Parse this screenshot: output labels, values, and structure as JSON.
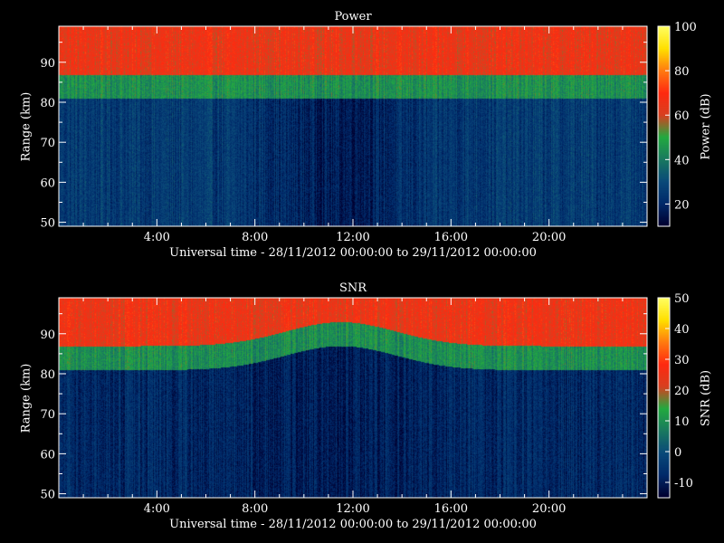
{
  "chart_data": [
    {
      "type": "heatmap",
      "title": "Power",
      "xlabel": "Universal time - 28/11/2012 00:00:00 to 29/11/2012 00:00:00",
      "ylabel": "Range (km)",
      "colorbar_label": "Power (dB)",
      "x_range_hours": [
        0,
        24
      ],
      "y_range_km": [
        49,
        99
      ],
      "x_ticks": [
        "4:00",
        "8:00",
        "12:00",
        "16:00",
        "20:00"
      ],
      "x_tick_hours": [
        4,
        8,
        12,
        16,
        20
      ],
      "y_ticks": [
        50,
        60,
        70,
        80,
        90
      ],
      "colorbar_range": [
        10,
        100
      ],
      "colorbar_ticks": [
        20,
        40,
        60,
        80,
        100
      ],
      "colormap": [
        "#000030",
        "#002a6a",
        "#0a4a7a",
        "#1a7a60",
        "#22aa40",
        "#d84020",
        "#ff2a10",
        "#ff7a10",
        "#ffe000",
        "#ffff60"
      ],
      "description_levels": {
        "low_ranges_dB": 25,
        "mid_layer_dB": 45,
        "upper_ranges_dB": 65,
        "layer_boundary_km": 83
      }
    },
    {
      "type": "heatmap",
      "title": "SNR",
      "xlabel": "Universal time - 28/11/2012 00:00:00 to 29/11/2012 00:00:00",
      "ylabel": "Range (km)",
      "colorbar_label": "SNR (dB)",
      "x_range_hours": [
        0,
        24
      ],
      "y_range_km": [
        49,
        99
      ],
      "x_ticks": [
        "4:00",
        "8:00",
        "12:00",
        "16:00",
        "20:00"
      ],
      "x_tick_hours": [
        4,
        8,
        12,
        16,
        20
      ],
      "y_ticks": [
        50,
        60,
        70,
        80,
        90
      ],
      "colorbar_range": [
        -15,
        50
      ],
      "colorbar_ticks": [
        -10,
        0,
        10,
        20,
        30,
        40,
        50
      ],
      "colormap": [
        "#000030",
        "#002a6a",
        "#0a4a7a",
        "#1a7a60",
        "#22aa40",
        "#d84020",
        "#ff2a10",
        "#ff7a10",
        "#ffe000",
        "#ffff60"
      ],
      "description_levels": {
        "low_ranges_dB": -8,
        "mid_layer_dB": 10,
        "upper_ranges_dB": 25,
        "layer_boundary_km": 83
      }
    }
  ]
}
